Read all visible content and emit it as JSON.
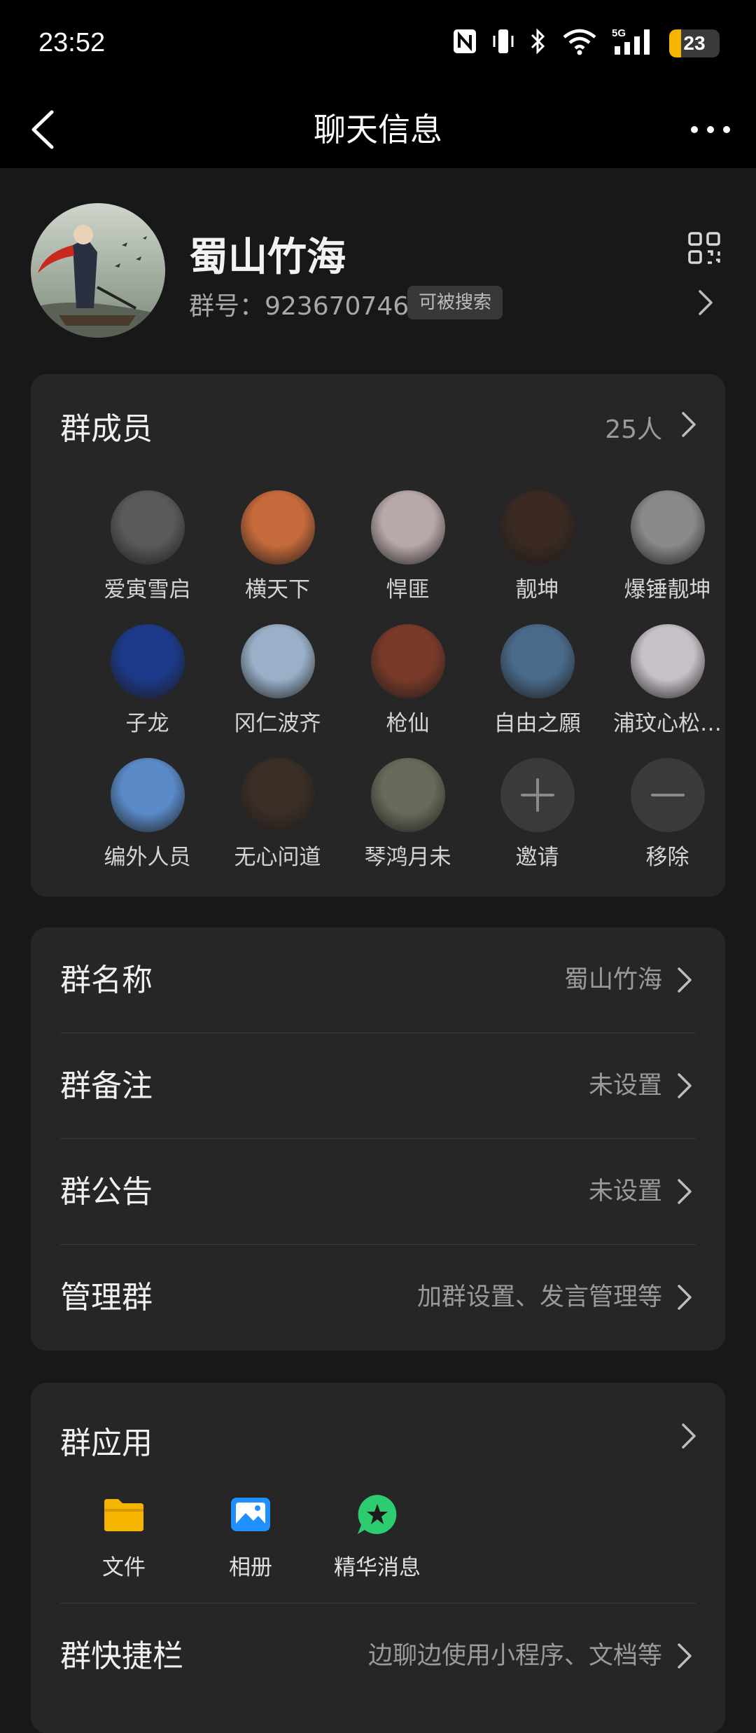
{
  "status_bar": {
    "time": "23:52",
    "battery_level": "23",
    "battery_fraction": 0.23,
    "icons": [
      "nfc-icon",
      "vibrate-icon",
      "bluetooth-icon",
      "wifi-icon",
      "5g-signal-icon",
      "battery-icon"
    ]
  },
  "nav": {
    "title": "聊天信息"
  },
  "group": {
    "name": "蜀山竹海",
    "number": "群号：923670746",
    "searchable_badge": "可被搜索"
  },
  "members": {
    "title": "群成员",
    "count": "25人",
    "items": [
      {
        "name": "爱寅雪启",
        "avatar_color": "#5a5a5a"
      },
      {
        "name": "横天下",
        "avatar_color": "#c56a3a"
      },
      {
        "name": "悍匪",
        "avatar_color": "#b9a8a8"
      },
      {
        "name": "靓坤",
        "avatar_color": "#3a2a22"
      },
      {
        "name": "爆锤靓坤",
        "avatar_color": "#8a8a8a"
      },
      {
        "name": "子龙",
        "avatar_color": "#1d3a8a"
      },
      {
        "name": "冈仁波齐",
        "avatar_color": "#9ab0c8"
      },
      {
        "name": "枪仙",
        "avatar_color": "#7a3a2a"
      },
      {
        "name": "自由之願",
        "avatar_color": "#4a6a8a"
      },
      {
        "name": "浦玟心松…",
        "avatar_color": "#c8c0c8"
      },
      {
        "name": "编外人员",
        "avatar_color": "#5a8ac8"
      },
      {
        "name": "无心问道",
        "avatar_color": "#3a2e26"
      },
      {
        "name": "琴鸿月未",
        "avatar_color": "#6a6a5a"
      }
    ],
    "invite_label": "邀请",
    "remove_label": "移除"
  },
  "settings": [
    {
      "label": "群名称",
      "value": "蜀山竹海"
    },
    {
      "label": "群备注",
      "value": "未设置"
    },
    {
      "label": "群公告",
      "value": "未设置"
    },
    {
      "label": "管理群",
      "value": "加群设置、发言管理等"
    }
  ],
  "group_apps": {
    "title": "群应用",
    "items": [
      {
        "label": "文件",
        "icon": "folder-icon",
        "color": "#f5b400"
      },
      {
        "label": "相册",
        "icon": "photo-album-icon",
        "color": "#1e90ff"
      },
      {
        "label": "精华消息",
        "icon": "star-bubble-icon",
        "color": "#2ecc71"
      }
    ]
  },
  "quick_bar": {
    "label": "群快捷栏",
    "value": "边聊边使用小程序、文档等"
  }
}
